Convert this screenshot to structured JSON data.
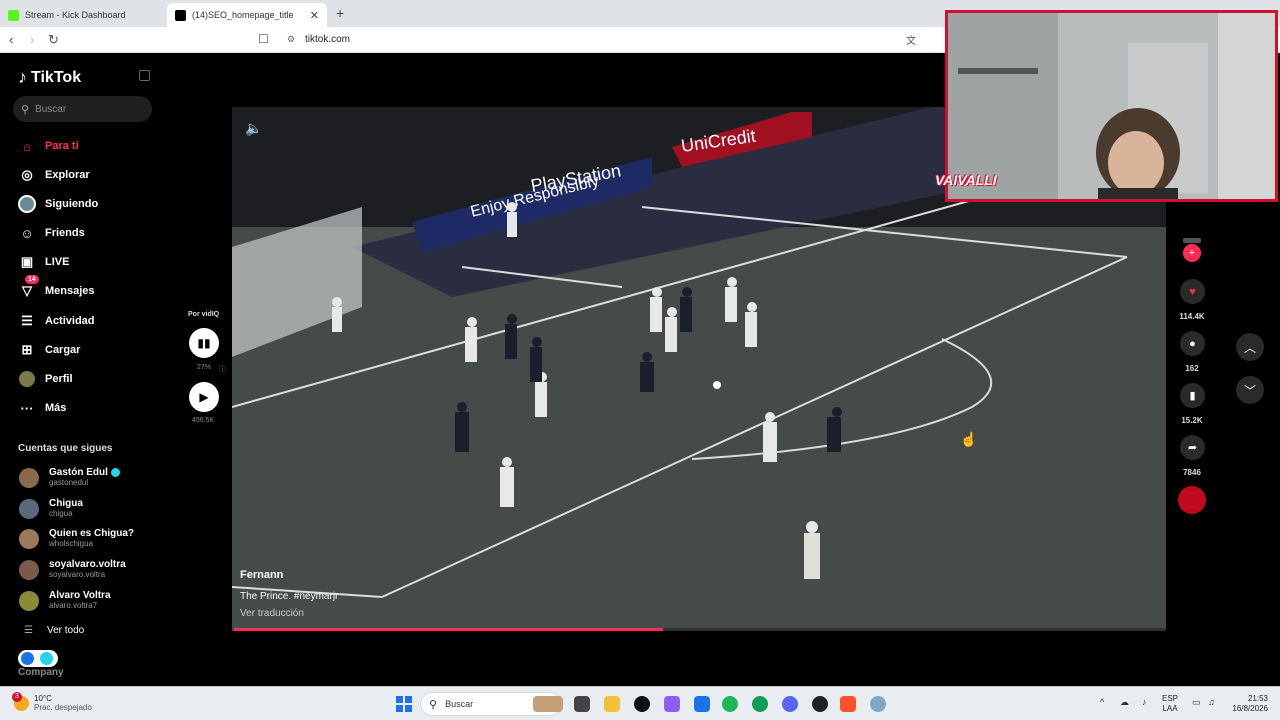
{
  "browser": {
    "tabs": [
      {
        "title": "Stream - Kick Dashboard",
        "favicon_color": "#53fc18"
      },
      {
        "title": "(14)SEO_homepage_title",
        "favicon_color": "#000000"
      }
    ],
    "new_tab": "+",
    "url": "tiktok.com"
  },
  "sidebar": {
    "logo": "TikTok",
    "search_placeholder": "Buscar",
    "nav": [
      {
        "label": "Para ti",
        "icon": "home-icon"
      },
      {
        "label": "Explorar",
        "icon": "compass-icon"
      },
      {
        "label": "Siguiendo",
        "icon": "following-icon"
      },
      {
        "label": "Friends",
        "icon": "friends-icon"
      },
      {
        "label": "LIVE",
        "icon": "live-icon"
      },
      {
        "label": "Mensajes",
        "icon": "messages-icon",
        "badge": "14"
      },
      {
        "label": "Actividad",
        "icon": "activity-icon"
      },
      {
        "label": "Cargar",
        "icon": "upload-icon"
      },
      {
        "label": "Perfil",
        "icon": "profile-icon"
      },
      {
        "label": "Más",
        "icon": "more-icon"
      }
    ],
    "following_title": "Cuentas que sigues",
    "following": [
      {
        "name": "Gastón Edul",
        "handle": "gastonedul",
        "verified": true
      },
      {
        "name": "Chigua",
        "handle": "chigua"
      },
      {
        "name": "Quien es Chigua?",
        "handle": "wholschigua"
      },
      {
        "name": "soyalvaro.voltra",
        "handle": "soyalvaro.voltra"
      },
      {
        "name": "Alvaro Voltra",
        "handle": "alvaro.voltra7"
      }
    ],
    "see_all": "Ver todo",
    "footer": "Company"
  },
  "vidiq": {
    "label": "Por vidIQ",
    "percent": "27%",
    "views": "456.5K"
  },
  "video": {
    "username": "Fernann",
    "description": "The Prince. #neymarjr",
    "translate": "Ver traducción",
    "progress": 0.46
  },
  "actions": {
    "likes": "114.4K",
    "comments": "162",
    "saves": "15.2K",
    "shares": "7846"
  },
  "webcam": {
    "tag": "VAIVALLI"
  },
  "taskbar": {
    "weather_temp": "10°C",
    "weather_desc": "Prac. despejado",
    "weather_badge": "3",
    "search_placeholder": "Buscar",
    "lang_top": "ESP",
    "lang_bottom": "LAA",
    "time": "21:53",
    "date": "16/8/2026"
  }
}
